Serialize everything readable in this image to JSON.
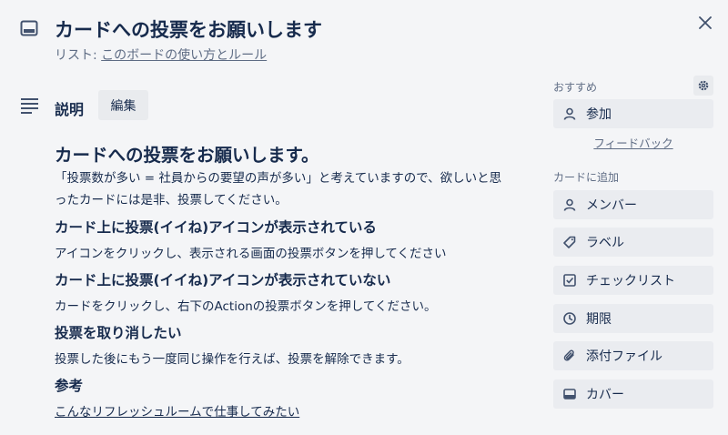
{
  "header": {
    "card_icon": "card-icon",
    "title": "カードへの投票をお願いします",
    "list_prefix": "リスト: ",
    "list_name": "このボードの使い方とルール",
    "close_icon": "close-icon"
  },
  "description": {
    "icon": "description-lines-icon",
    "title": "説明",
    "edit_label": "編集",
    "heading": "カードへの投票をお願いします。",
    "intro_line1": "「投票数が多い = 社員からの要望の声が多い」と考えていますので、欲しいと思",
    "intro_line2": "ったカードには是非、投票してください。",
    "sections": [
      {
        "heading": "カード上に投票(イイね)アイコンが表示されている",
        "text": "アイコンをクリックし、表示される画面の投票ボタンを押してください"
      },
      {
        "heading": "カード上に投票(イイね)アイコンが表示されていない",
        "text": "カードをクリックし、右下のActionの投票ボタンを押してください。"
      },
      {
        "heading": "投票を取り消したい",
        "text": "投票した後にもう一度同じ操作を行えば、投票を解除できます。"
      }
    ],
    "reference_heading": "参考",
    "reference_link": "こんなリフレッシュルームで仕事してみたい"
  },
  "sidebar": {
    "suggested_label": "おすすめ",
    "settings_icon": "gear-icon",
    "join_label": "参加",
    "feedback_label": "フィードバック",
    "add_to_card_label": "カードに追加",
    "buttons": [
      {
        "label": "メンバー",
        "icon": "person-icon"
      },
      {
        "label": "ラベル",
        "icon": "label-tag-icon"
      },
      {
        "label": "チェックリスト",
        "icon": "checkbox-icon"
      },
      {
        "label": "期限",
        "icon": "clock-icon"
      },
      {
        "label": "添付ファイル",
        "icon": "paperclip-icon"
      },
      {
        "label": "カバー",
        "icon": "cover-icon"
      }
    ]
  }
}
